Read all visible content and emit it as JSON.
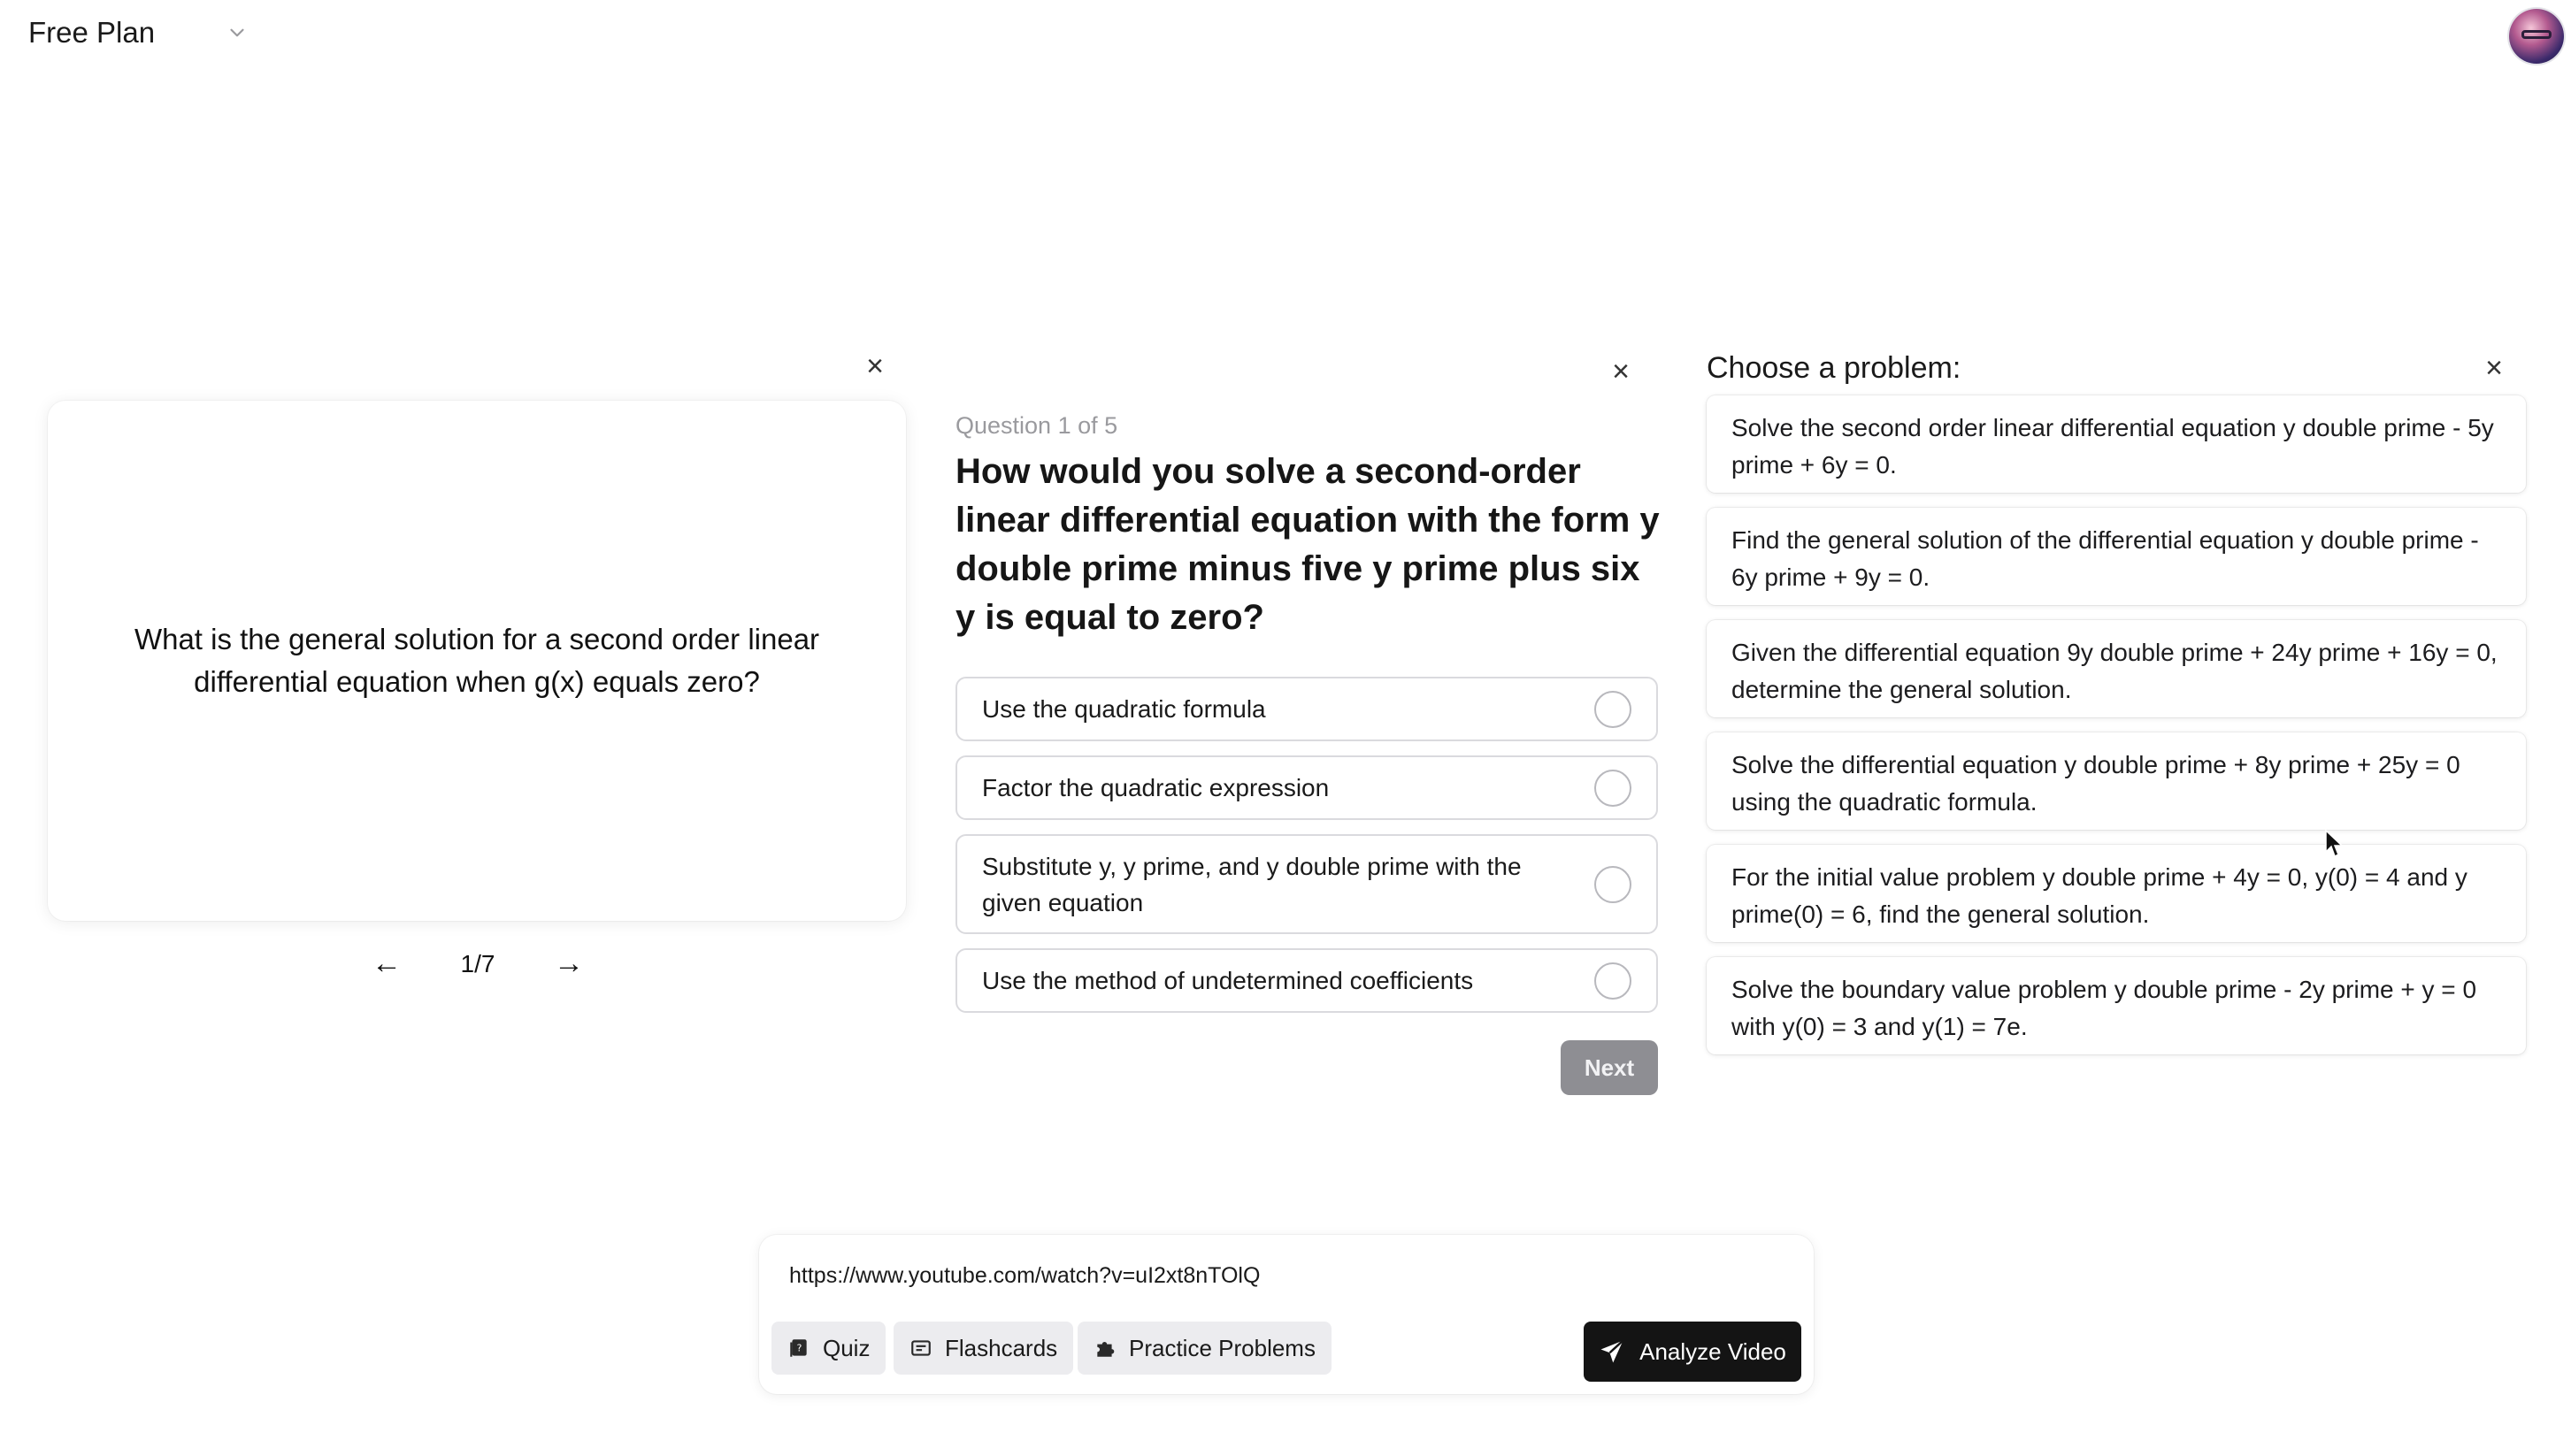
{
  "header": {
    "plan_label": "Free Plan"
  },
  "flashcards": {
    "text": "What is the general solution for a second order linear differential equation when g(x) equals zero?",
    "counter": "1/7",
    "prev_icon": "←",
    "next_icon": "→"
  },
  "quiz": {
    "counter": "Question 1 of 5",
    "question": "How would you solve a second-order linear differential equation with the form y double prime minus five y prime plus six y is equal to zero?",
    "options": [
      "Use the quadratic formula",
      "Factor the quadratic expression",
      "Substitute y, y prime, and y double prime with the given equation",
      "Use the method of undetermined coefficients"
    ],
    "next_label": "Next"
  },
  "practice": {
    "title": "Choose a problem:",
    "problems": [
      "Solve the second order linear differential equation y double prime - 5y prime + 6y = 0.",
      "Find the general solution of the differential equation y double prime - 6y prime + 9y = 0.",
      "Given the differential equation 9y double prime + 24y prime + 16y = 0, determine the general solution.",
      "Solve the differential equation y double prime + 8y prime + 25y = 0 using the quadratic formula.",
      "For the initial value problem y double prime + 4y = 0, y(0) = 4 and y prime(0) = 6, find the general solution.",
      "Solve the boundary value problem y double prime - 2y prime + y = 0 with y(0) = 3 and y(1) = 7e."
    ]
  },
  "input": {
    "url_value": "https://www.youtube.com/watch?v=uI2xt8nTOlQ",
    "modes": {
      "quiz": "Quiz",
      "flashcards": "Flashcards",
      "practice": "Practice Problems"
    },
    "analyze_label": "Analyze Video"
  },
  "close_icon": "×"
}
